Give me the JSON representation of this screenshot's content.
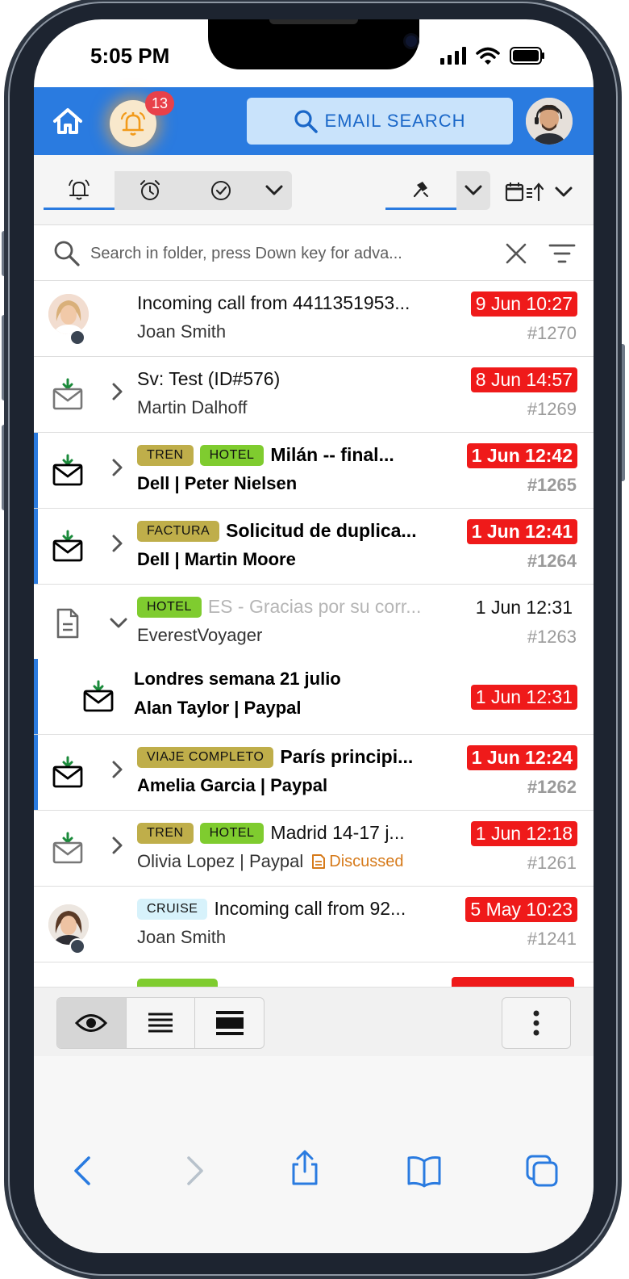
{
  "status_bar": {
    "time": "5:05 PM"
  },
  "header": {
    "notification_count": "13",
    "search_button_label": "EMAIL SEARCH"
  },
  "search": {
    "placeholder": "Search in folder, press Down key for adva..."
  },
  "messages": [
    {
      "subject": "Incoming call from 4411351953...",
      "from": "Joan Smith",
      "date": "9 Jun 10:27",
      "number": "#1270"
    },
    {
      "subject": "Sv: Test (ID#576)",
      "from": "Martin Dalhoff",
      "date": "8 Jun 14:57",
      "number": "#1269"
    },
    {
      "tags": [
        "TREN",
        "HOTEL"
      ],
      "subject": "Milán -- final...",
      "from": "Dell | Peter Nielsen",
      "date": "1 Jun 12:42",
      "number": "#1265"
    },
    {
      "tags": [
        "FACTURA"
      ],
      "subject": "Solicitud de duplica...",
      "from": "Dell | Martin Moore",
      "date": "1 Jun 12:41",
      "number": "#1264"
    },
    {
      "tags": [
        "HOTEL"
      ],
      "subject": "ES - Gracias por su corr...",
      "from": "EverestVoyager",
      "date": "1 Jun 12:31",
      "number": "#1263"
    },
    {
      "subject": "Londres semana 21 julio",
      "from": "Alan Taylor | Paypal",
      "date": "1 Jun 12:31"
    },
    {
      "tags": [
        "VIAJE COMPLETO"
      ],
      "subject": "París principi...",
      "from": "Amelia Garcia | Paypal",
      "date": "1 Jun 12:24",
      "number": "#1262"
    },
    {
      "tags": [
        "TREN",
        "HOTEL"
      ],
      "subject": "Madrid 14-17 j...",
      "from": "Olivia Lopez | Paypal",
      "note": "Discussed",
      "date": "1 Jun 12:18",
      "number": "#1261"
    },
    {
      "tags": [
        "CRUISE"
      ],
      "subject": "Incoming call from 92...",
      "from": "Joan Smith",
      "date": "5 May 10:23",
      "number": "#1241"
    }
  ],
  "colors": {
    "header_bg": "#2a7be0",
    "date_badge": "#ef1a1a",
    "tag_tren": "#bfae4a",
    "tag_hotel": "#7fcc2f",
    "tag_cruise": "#d7f2fb",
    "discussed": "#d67a1a"
  }
}
